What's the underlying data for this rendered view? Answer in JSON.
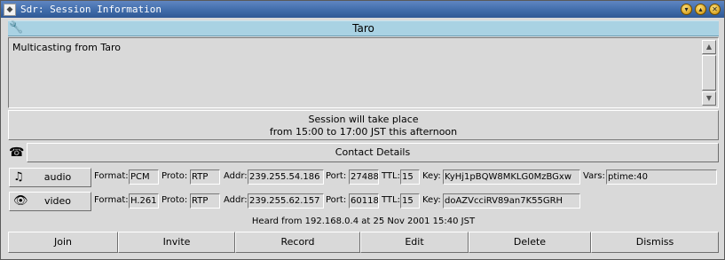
{
  "window": {
    "title": "Sdr: Session Information",
    "buttons": [
      "minimize-icon",
      "maximize-icon",
      "close-icon"
    ]
  },
  "session": {
    "name": "Taro",
    "description": "Multicasting from Taro",
    "time_line1": "Session will take place",
    "time_line2": "from 15:00 to 17:00 JST this afternoon",
    "contact_label": "Contact Details"
  },
  "labels": {
    "format": "Format:",
    "proto": "Proto:",
    "addr": "Addr:",
    "port": "Port:",
    "ttl": "TTL:",
    "key": "Key:",
    "vars": "Vars:"
  },
  "media": [
    {
      "name": "audio",
      "icon": "music-note-icon",
      "format": "PCM",
      "proto": "RTP",
      "addr": "239.255.54.186",
      "port": "27488",
      "ttl": "15",
      "key": "KyHj1pBQW8MKLG0MzBGxw",
      "vars": "ptime:40"
    },
    {
      "name": "video",
      "icon": "eye-icon",
      "format": "H.261",
      "proto": "RTP",
      "addr": "239.255.62.157",
      "port": "60118",
      "ttl": "15",
      "key": "doAZVcciRV89an7K55GRH"
    }
  ],
  "heard_from": "Heard from 192.168.0.4 at 25 Nov 2001 15:40 JST",
  "buttons": {
    "join": "Join",
    "invite": "Invite",
    "record": "Record",
    "edit": "Edit",
    "delete": "Delete",
    "dismiss": "Dismiss"
  },
  "colors": {
    "titlebar": "#3e6aa8",
    "header": "#a9d2e3",
    "background": "#d9d9d9"
  }
}
